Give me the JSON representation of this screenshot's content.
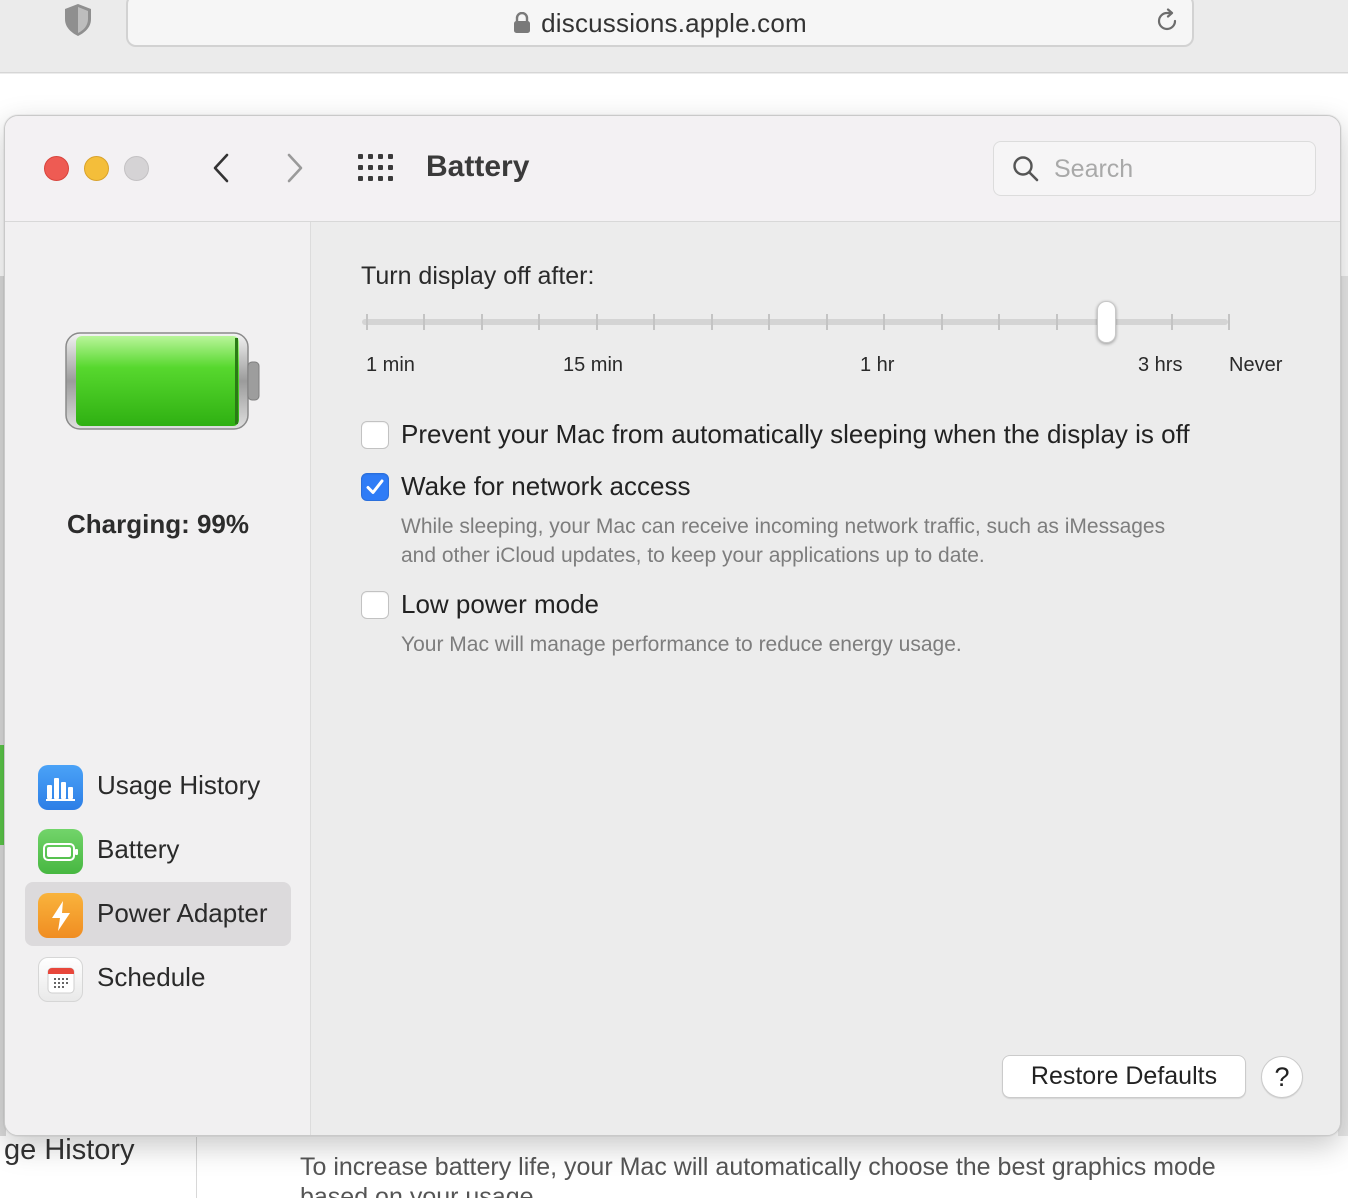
{
  "browser": {
    "url": "discussions.apple.com",
    "shield_icon": "shield-icon",
    "lock_icon": "lock-icon",
    "reload_icon": "reload-icon"
  },
  "background_page": {
    "left_text": "ge History",
    "bottom_text": "To increase battery life, your Mac will automatically choose the best graphics mode",
    "bottom_text_2": "based on your usage"
  },
  "window": {
    "title": "Battery",
    "search_placeholder": "Search",
    "colors": {
      "close": "#ee5b53",
      "minimize": "#f4be3a",
      "maximize": "#d5d3d5",
      "accent": "#2f7cf6"
    }
  },
  "sidebar": {
    "charging_status": "Charging: 99%",
    "items": [
      {
        "label": "Usage History",
        "icon": "usage-history-icon",
        "selected": false
      },
      {
        "label": "Battery",
        "icon": "battery-icon",
        "selected": false
      },
      {
        "label": "Power Adapter",
        "icon": "power-adapter-icon",
        "selected": true
      },
      {
        "label": "Schedule",
        "icon": "schedule-icon",
        "selected": false
      }
    ]
  },
  "display_slider": {
    "title": "Turn display off after:",
    "labels": [
      "1 min",
      "15 min",
      "1 hr",
      "3 hrs",
      "Never"
    ],
    "tick_count": 16,
    "selected_tick_index": 13
  },
  "options": [
    {
      "label": "Prevent your Mac from automatically sleeping when the display is off",
      "checked": false,
      "description": []
    },
    {
      "label": "Wake for network access",
      "checked": true,
      "description": [
        "While sleeping, your Mac can receive incoming network traffic, such as iMessages",
        "and other iCloud updates, to keep your applications up to date."
      ]
    },
    {
      "label": "Low power mode",
      "checked": false,
      "description": [
        "Your Mac will manage performance to reduce energy usage."
      ]
    }
  ],
  "footer": {
    "restore_label": "Restore Defaults",
    "help_label": "?"
  }
}
